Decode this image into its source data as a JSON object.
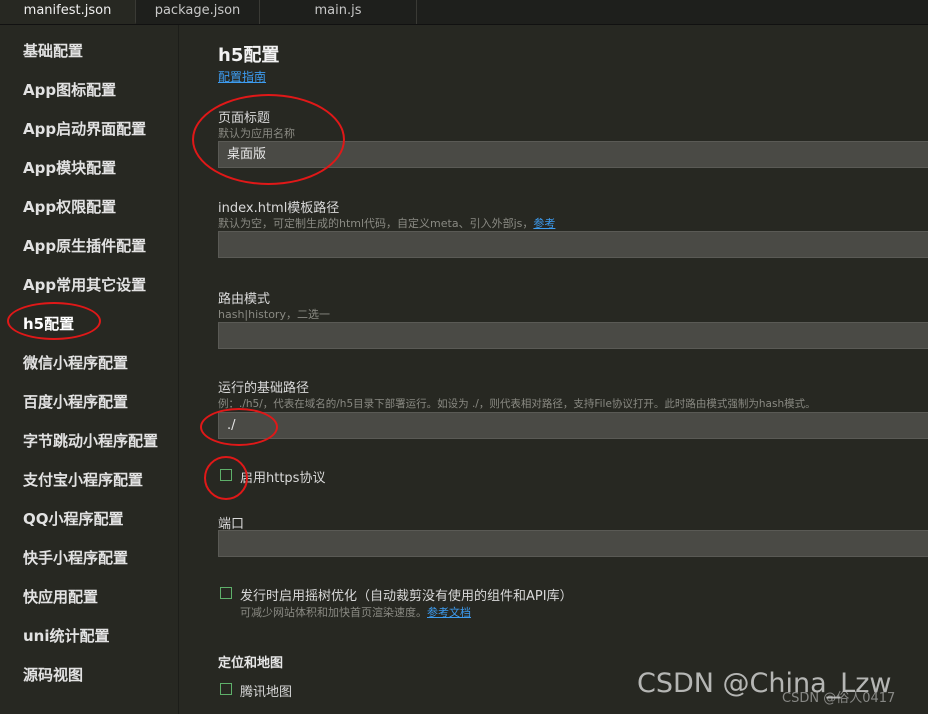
{
  "tabs": [
    "manifest.json",
    "package.json",
    "main.js"
  ],
  "sidebar": {
    "items": [
      {
        "label": "基础配置"
      },
      {
        "label": "App图标配置"
      },
      {
        "label": "App启动界面配置"
      },
      {
        "label": "App模块配置"
      },
      {
        "label": "App权限配置"
      },
      {
        "label": "App原生插件配置"
      },
      {
        "label": "App常用其它设置"
      },
      {
        "label": "h5配置"
      },
      {
        "label": "微信小程序配置"
      },
      {
        "label": "百度小程序配置"
      },
      {
        "label": "字节跳动小程序配置"
      },
      {
        "label": "支付宝小程序配置"
      },
      {
        "label": "QQ小程序配置"
      },
      {
        "label": "快手小程序配置"
      },
      {
        "label": "快应用配置"
      },
      {
        "label": "uni统计配置"
      },
      {
        "label": "源码视图"
      }
    ],
    "active_index": 7
  },
  "main": {
    "title": "h5配置",
    "guide_link": "配置指南",
    "page_title": {
      "label": "页面标题",
      "desc": "默认为应用名称",
      "value": "桌面版"
    },
    "index_template": {
      "label": "index.html模板路径",
      "desc": "默认为空，可定制生成的html代码，自定义meta、引入外部js，",
      "desc_link": "参考",
      "value": ""
    },
    "router_mode": {
      "label": "路由模式",
      "desc": "hash|history，二选一",
      "value": ""
    },
    "base_path": {
      "label": "运行的基础路径",
      "desc": "例：./h5/，代表在域名的/h5目录下部署运行。如设为 ./，则代表相对路径，支持File协议打开。此时路由模式强制为hash模式。",
      "value": "./"
    },
    "https": {
      "label": "启用https协议",
      "checked": false
    },
    "port": {
      "label": "端口",
      "value": ""
    },
    "treeshake": {
      "label": "发行时启用摇树优化（自动裁剪没有使用的组件和API库）",
      "desc": "可减少网站体积和加快首页渲染速度。",
      "desc_link": "参考文档",
      "checked": false
    },
    "map_section": {
      "title": "定位和地图",
      "tencent": {
        "label": "腾讯地图",
        "checked": false
      }
    }
  },
  "watermark": {
    "main": "CSDN @China_Lzw",
    "small": "CSDN @俗人0417"
  },
  "colors": {
    "annotation": "#e01818",
    "link": "#3d9cf0",
    "checkbox": "#5eb06a"
  }
}
